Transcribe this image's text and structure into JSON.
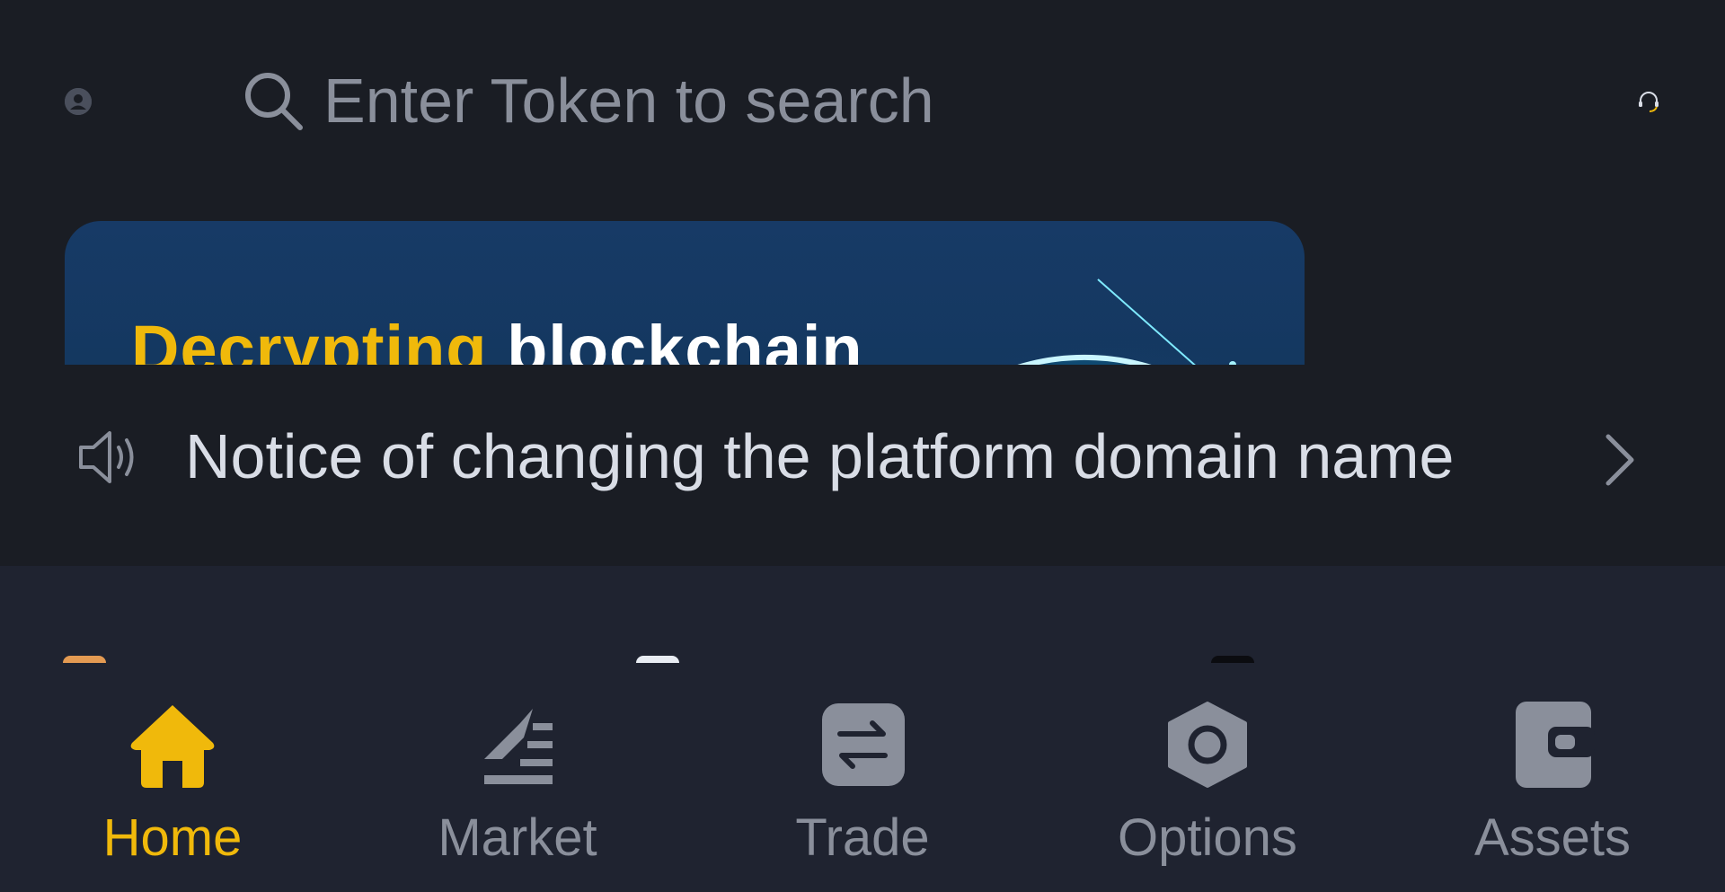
{
  "header": {
    "search_placeholder": "Enter Token to search",
    "avatar_icon": "user-avatar-icon",
    "support_icon": "headset-icon"
  },
  "banner": {
    "headline_accent": "Decrypting",
    "headline_main": "blockchain"
  },
  "notice": {
    "text": "Notice of changing the platform domain name",
    "icon": "speaker-icon",
    "arrow_icon": "chevron-right-icon"
  },
  "bottom_nav": {
    "items": [
      {
        "label": "Home",
        "icon": "home-icon",
        "active": true
      },
      {
        "label": "Market",
        "icon": "market-icon",
        "active": false
      },
      {
        "label": "Trade",
        "icon": "trade-icon",
        "active": false
      },
      {
        "label": "Options",
        "icon": "options-icon",
        "active": false
      },
      {
        "label": "Assets",
        "icon": "wallet-icon",
        "active": false
      }
    ]
  },
  "colors": {
    "background": "#1a1d24",
    "panel": "#1f2330",
    "accent": "#f0b90b",
    "muted": "#8a8f9b",
    "text": "#d9dde6",
    "banner": "#173a66"
  }
}
